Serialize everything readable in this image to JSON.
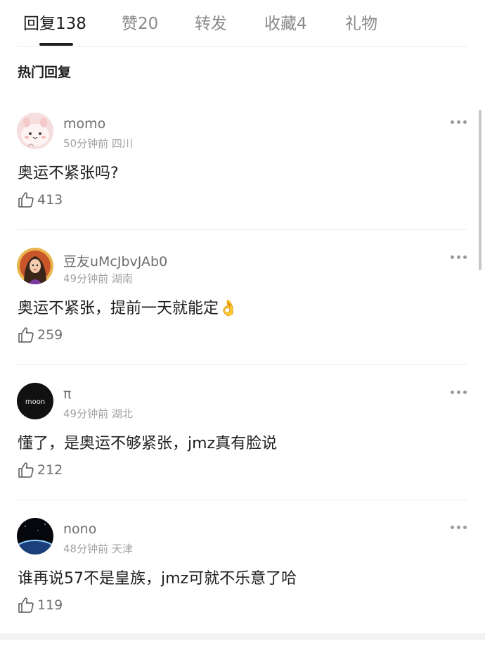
{
  "tabs": [
    {
      "label": "回复138",
      "active": true
    },
    {
      "label": "赞20",
      "active": false
    },
    {
      "label": "转发",
      "active": false
    },
    {
      "label": "收藏4",
      "active": false
    },
    {
      "label": "礼物",
      "active": false
    }
  ],
  "section_title": "热门回复",
  "comments": [
    {
      "username": "momo",
      "meta": "50分钟前 四川",
      "text": "奥运不紧张吗?",
      "likes": "413",
      "avatar_icon": "pink-bunny-avatar"
    },
    {
      "username": "豆友uMcJbvJAb0",
      "meta": "49分钟前 湖南",
      "text": "奥运不紧张，提前一天就能定",
      "emoji": "👌",
      "likes": "259",
      "avatar_icon": "illustrated-girl-avatar"
    },
    {
      "username": "π",
      "meta": "49分钟前 湖北",
      "text": "懂了，是奥运不够紧张，jmz真有脸说",
      "likes": "212",
      "avatar_icon": "moon-avatar",
      "avatar_text": "moon"
    },
    {
      "username": "nono",
      "meta": "48分钟前 天津",
      "text": "谁再说57不是皇族，jmz可就不乐意了哈",
      "likes": "119",
      "avatar_icon": "earth-horizon-avatar"
    }
  ],
  "colors": {
    "text": "#1f1f1f",
    "secondary": "#6e6e6e",
    "meta": "#a2a2a2",
    "divider": "#ececec"
  }
}
